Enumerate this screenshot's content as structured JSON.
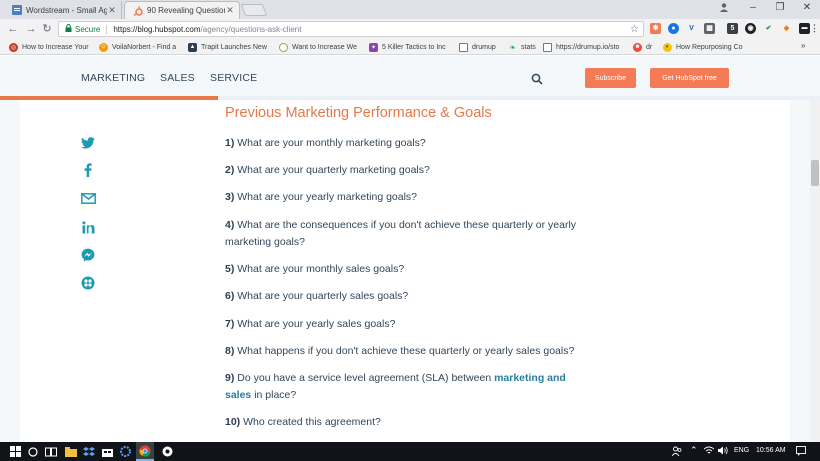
{
  "browser": {
    "tabs": [
      {
        "title": "Wordstream - Small Age",
        "active": false
      },
      {
        "title": "90 Revealing Questions t",
        "active": true
      }
    ],
    "address": {
      "secure_label": "Secure",
      "url_host": "https://blog.hubspot.com",
      "url_path": "/agency/questions-ask-client"
    },
    "bookmarks": [
      {
        "label": "How to Increase Your",
        "icon": "globe-icon",
        "color": "#c0392b"
      },
      {
        "label": "VoilaNorbert - Find a",
        "icon": "norbert-icon",
        "color": "#f39c12"
      },
      {
        "label": "Trapit Launches New",
        "icon": "trapit-icon",
        "color": "#2c3e50"
      },
      {
        "label": "Want to Increase We",
        "icon": "circle-icon",
        "color": "#7cb342"
      },
      {
        "label": "5 Killer Tactics to Inc",
        "icon": "star-icon",
        "color": "#8e44ad"
      },
      {
        "label": "drumup",
        "icon": "page-icon",
        "color": "#ffffff"
      },
      {
        "label": "stats",
        "icon": "stats-icon",
        "color": "#27ae60"
      },
      {
        "label": "https://drumup.io/sto",
        "icon": "page-icon",
        "color": "#ffffff"
      },
      {
        "label": "dr",
        "icon": "dr-icon",
        "color": "#e74c3c"
      },
      {
        "label": "How Repurposing Co",
        "icon": "repurpose-icon",
        "color": "#d35400"
      }
    ]
  },
  "site": {
    "nav": [
      "MARKETING",
      "SALES",
      "SERVICE"
    ],
    "subscribe_label": "Subscribe",
    "get_free_label": "Get HubSpot free",
    "accent": "#f47b56",
    "read_progress": 0.266
  },
  "article": {
    "section_title": "Previous Marketing Performance & Goals",
    "questions": [
      {
        "num": "1)",
        "text": "What are your monthly marketing goals?"
      },
      {
        "num": "2)",
        "text": "What are your quarterly marketing goals?"
      },
      {
        "num": "3)",
        "text": "What are your yearly marketing goals?"
      },
      {
        "num": "4)",
        "text": "What are the consequences if you don't achieve these quarterly or yearly marketing goals?"
      },
      {
        "num": "5)",
        "text": "What are your monthly sales goals?"
      },
      {
        "num": "6)",
        "text": "What are your quarterly sales goals?"
      },
      {
        "num": "7)",
        "text": "What are your yearly sales goals?"
      },
      {
        "num": "8)",
        "text": "What happens if you don't achieve these quarterly or yearly sales goals?"
      },
      {
        "num": "9)",
        "text_before": "Do you have a service level agreement (SLA) between ",
        "link": "marketing and sales",
        "text_after": " in place?"
      },
      {
        "num": "10)",
        "text": "Who created this agreement?"
      }
    ]
  },
  "share_icons": [
    "twitter-icon",
    "facebook-icon",
    "email-icon",
    "linkedin-icon",
    "messenger-icon",
    "share-more-icon"
  ],
  "share_color": "#1d9bb2",
  "taskbar": {
    "language": "ENG",
    "time": "10:56 AM"
  }
}
